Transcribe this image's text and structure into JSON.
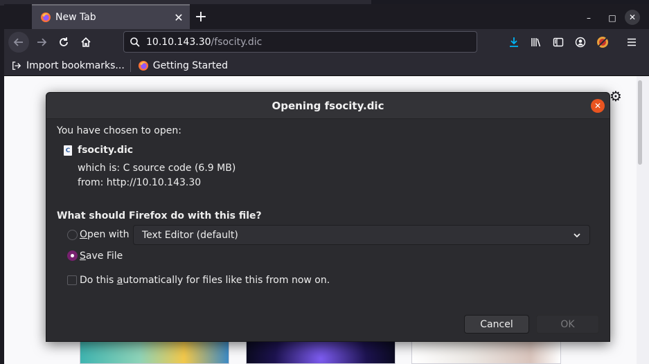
{
  "tab": {
    "title": "New Tab"
  },
  "window": {
    "minimize": "–",
    "maximize": "□",
    "close": "✕"
  },
  "urlbar": {
    "host": "10.10.143.30",
    "path": "/fsocity.dic"
  },
  "bookmarks": [
    {
      "label": "Import bookmarks...",
      "icon": "import-icon"
    },
    {
      "label": "Getting Started",
      "icon": "firefox-icon"
    }
  ],
  "dialog": {
    "title": "Opening fsocity.dic",
    "chosen_label": "You have chosen to open:",
    "file_name": "fsocity.dic",
    "file_icon_letter": "C",
    "which_is": "which is:  C source code (6.9 MB)",
    "from": "from:  http://10.10.143.30",
    "question": "What should Firefox do with this file?",
    "open_with_prefix": "O",
    "open_with_rest": "pen with",
    "app_selected": "Text Editor (default)",
    "save_prefix": "S",
    "save_rest": "ave File",
    "auto_pre": "Do this ",
    "auto_underline": "a",
    "auto_post": "utomatically for files like this from now on.",
    "cancel": "Cancel",
    "ok": "OK",
    "selected_option": "save_file",
    "auto_checked": false
  },
  "colors": {
    "accent_orange": "#e95420",
    "radio_selected": "#77216f",
    "download_icon": "#00ddff"
  }
}
